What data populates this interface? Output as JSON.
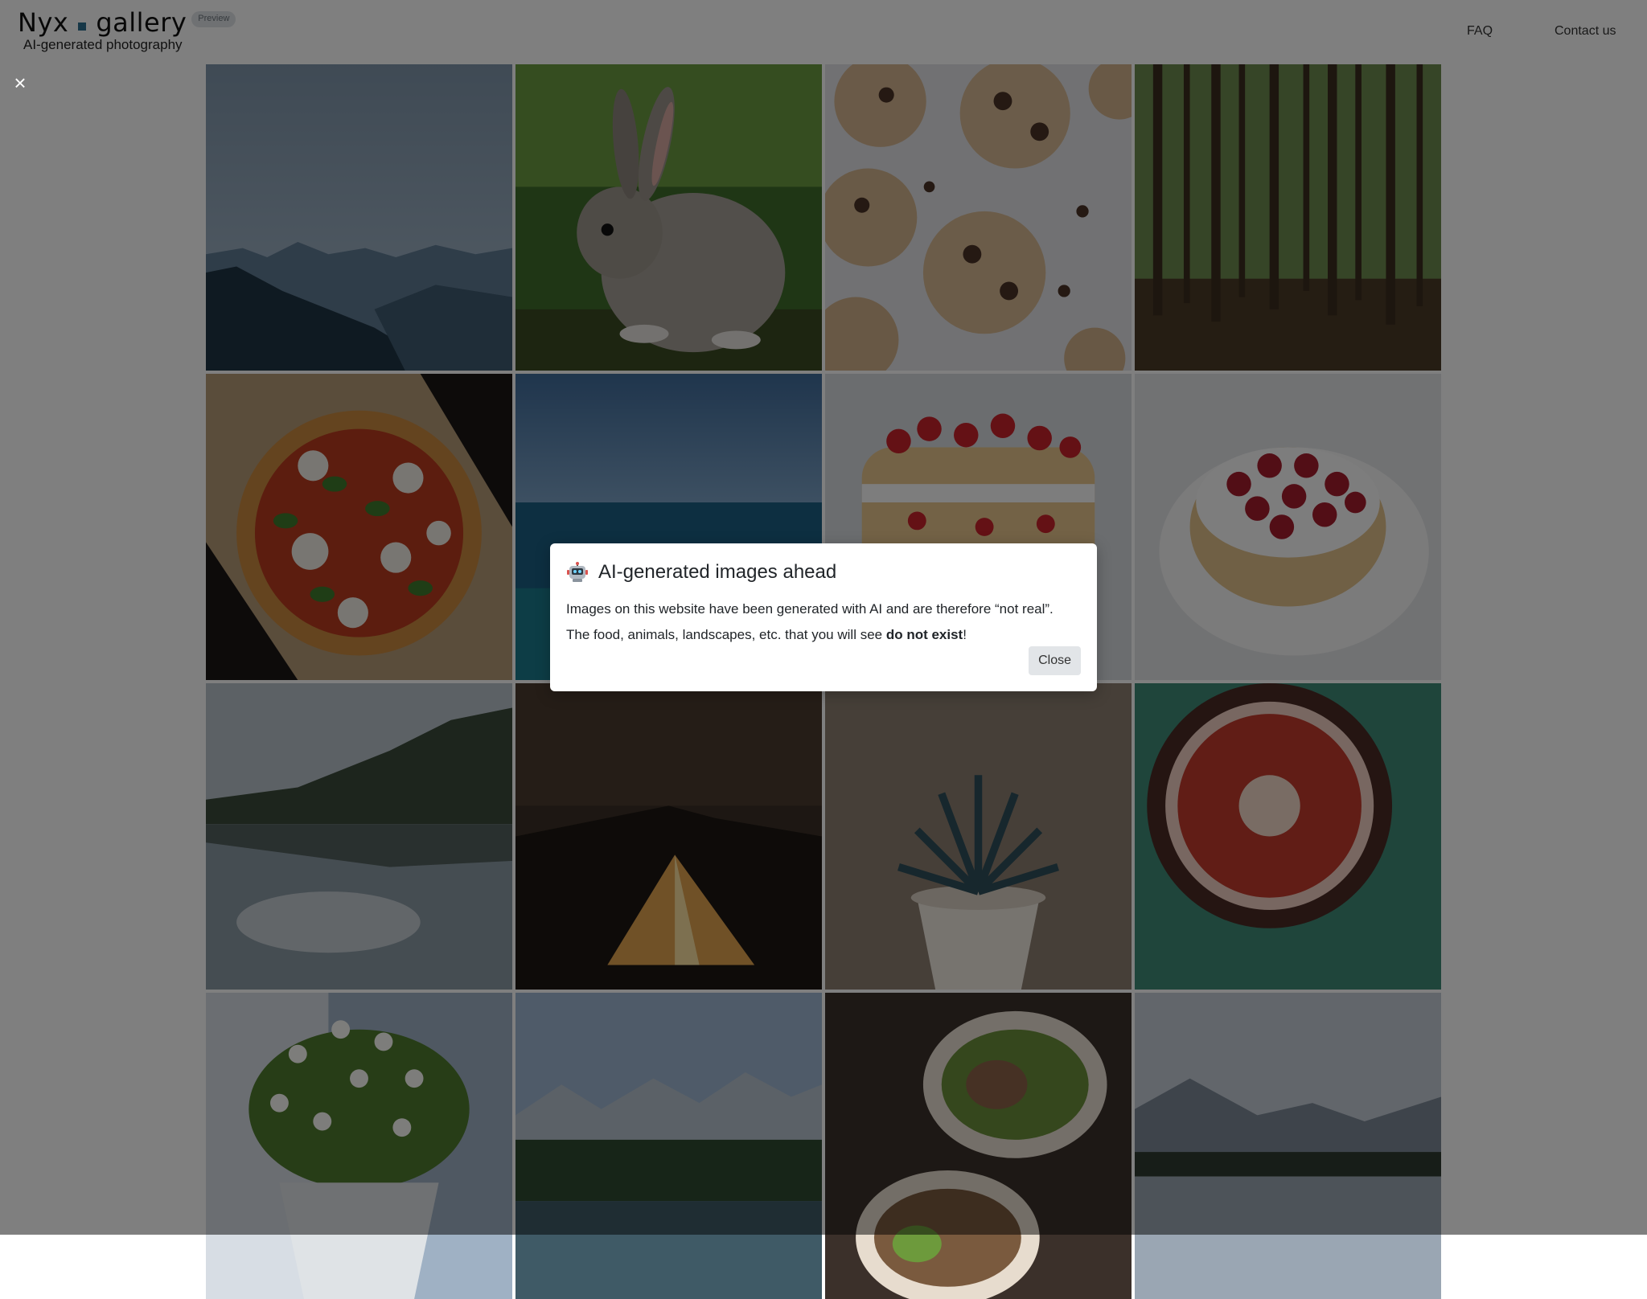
{
  "header": {
    "brand_part1": "Nyx",
    "brand_part2": "gallery",
    "badge": "Preview",
    "tagline": "AI-generated photography",
    "nav": {
      "faq": "FAQ",
      "contact": "Contact us"
    }
  },
  "overlay": {
    "close_icon": "×",
    "modal": {
      "title": "AI-generated images ahead",
      "icon": "robot-icon",
      "body_line1": "Images on this website have been generated with AI and are therefore “not real”.",
      "body_line2_prefix": "The food, animals, landscapes, etc. that you will see ",
      "body_line2_bold": "do not exist",
      "body_line2_suffix": "!",
      "close_label": "Close"
    }
  },
  "gallery": [
    "mountain-haze-image",
    "rabbit-image",
    "cookies-image",
    "forest-image",
    "pizza-image",
    "sea-image",
    "strawberry-cake-image",
    "raspberry-tart-image",
    "lake-reflection-image",
    "tent-night-image",
    "succulent-plant-image",
    "fig-image",
    "flower-pot-image",
    "alpine-lake-image",
    "burrito-image",
    "mountain-lake-image"
  ],
  "colors": {
    "accent": "#2c6e8f",
    "badge_bg": "#dfe3e7",
    "button_bg": "#e2e5e8"
  }
}
